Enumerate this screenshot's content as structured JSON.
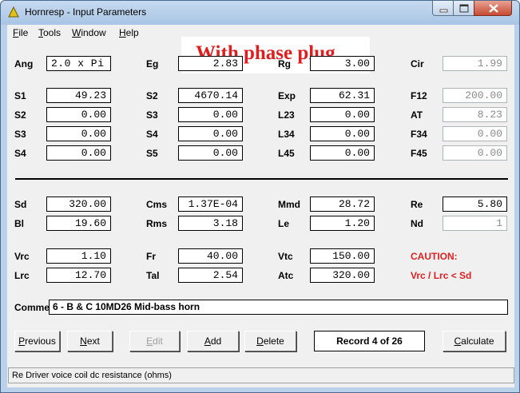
{
  "window": {
    "title": "Hornresp - Input Parameters"
  },
  "menu": {
    "file": "File",
    "tools": "Tools",
    "window": "Window",
    "help": "Help"
  },
  "banner": "With phase plug",
  "params": {
    "ang": {
      "label": "Ang",
      "value": "2.0 x Pi"
    },
    "eg": {
      "label": "Eg",
      "value": "2.83"
    },
    "rg": {
      "label": "Rg",
      "value": "3.00"
    },
    "cir": {
      "label": "Cir",
      "value": "1.99"
    },
    "s1": {
      "label": "S1",
      "value": "49.23"
    },
    "s2a": {
      "label": "S2",
      "value": "4670.14"
    },
    "exp": {
      "label": "Exp",
      "value": "62.31"
    },
    "f12": {
      "label": "F12",
      "value": "200.00"
    },
    "s2": {
      "label": "S2",
      "value": "0.00"
    },
    "s3a": {
      "label": "S3",
      "value": "0.00"
    },
    "l23": {
      "label": "L23",
      "value": "0.00"
    },
    "at": {
      "label": "AT",
      "value": "8.23"
    },
    "s3": {
      "label": "S3",
      "value": "0.00"
    },
    "s4a": {
      "label": "S4",
      "value": "0.00"
    },
    "l34": {
      "label": "L34",
      "value": "0.00"
    },
    "f34": {
      "label": "F34",
      "value": "0.00"
    },
    "s4": {
      "label": "S4",
      "value": "0.00"
    },
    "s5": {
      "label": "S5",
      "value": "0.00"
    },
    "l45": {
      "label": "L45",
      "value": "0.00"
    },
    "f45": {
      "label": "F45",
      "value": "0.00"
    },
    "sd": {
      "label": "Sd",
      "value": "320.00"
    },
    "cms": {
      "label": "Cms",
      "value": "1.37E-04"
    },
    "mmd": {
      "label": "Mmd",
      "value": "28.72"
    },
    "re": {
      "label": "Re",
      "value": "5.80"
    },
    "bl": {
      "label": "Bl",
      "value": "19.60"
    },
    "rms": {
      "label": "Rms",
      "value": "3.18"
    },
    "le": {
      "label": "Le",
      "value": "1.20"
    },
    "nd": {
      "label": "Nd",
      "value": "1"
    },
    "vrc": {
      "label": "Vrc",
      "value": "1.10"
    },
    "fr": {
      "label": "Fr",
      "value": "40.00"
    },
    "vtc": {
      "label": "Vtc",
      "value": "150.00"
    },
    "lrc": {
      "label": "Lrc",
      "value": "12.70"
    },
    "tal": {
      "label": "Tal",
      "value": "2.54"
    },
    "atc": {
      "label": "Atc",
      "value": "320.00"
    }
  },
  "caution": {
    "title": "CAUTION:",
    "message": "Vrc / Lrc < Sd"
  },
  "comment": {
    "label": "Comment",
    "value": "6 - B & C 10MD26 Mid-bass horn"
  },
  "buttons": {
    "previous": "Previous",
    "next": "Next",
    "edit": "Edit",
    "add": "Add",
    "delete": "Delete",
    "calculate": "Calculate"
  },
  "record": "Record 4 of 26",
  "status": "Re   Driver voice coil dc resistance (ohms)",
  "colors": {
    "caution": "#e02020",
    "banner": "#dd1f1f",
    "titlebar": "#b9d1ea"
  }
}
